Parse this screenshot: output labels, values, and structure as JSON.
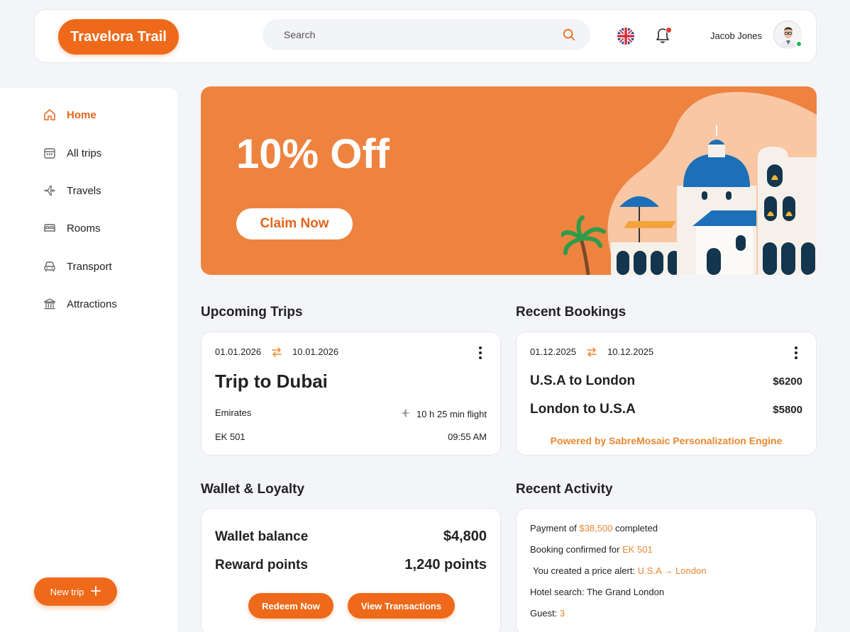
{
  "header": {
    "logo": "Travelora Trail",
    "search_placeholder": "Search",
    "user_name": "Jacob Jones"
  },
  "sidebar": {
    "items": [
      {
        "label": "Home",
        "icon": "home-icon",
        "active": true
      },
      {
        "label": "All trips",
        "icon": "calendar-icon"
      },
      {
        "label": "Travels",
        "icon": "plane-icon"
      },
      {
        "label": "Rooms",
        "icon": "bed-icon"
      },
      {
        "label": "Transport",
        "icon": "car-icon"
      },
      {
        "label": "Attractions",
        "icon": "museum-icon"
      }
    ],
    "new_trip": "New trip"
  },
  "banner": {
    "title": "10% Off",
    "button": "Claim Now"
  },
  "upcoming": {
    "title": "Upcoming Trips",
    "date_from": "01.01.2026",
    "date_to": "10.01.2026",
    "trip_title": "Trip to Dubai",
    "airline": "Emirates",
    "duration": "10 h 25 min flight",
    "flight_no": "EK 501",
    "time": "09:55 AM"
  },
  "bookings": {
    "title": "Recent Bookings",
    "date_from": "01.12.2025",
    "date_to": "10.12.2025",
    "items": [
      {
        "route": "U.S.A to London",
        "price": "$6200"
      },
      {
        "route": "London to U.S.A",
        "price": "$5800"
      }
    ],
    "powered": "Powered by SabreMosaic Personalization Engine"
  },
  "wallet": {
    "title": "Wallet & Loyalty",
    "balance_label": "Wallet balance",
    "balance_value": "$4,800",
    "points_label": "Reward points",
    "points_value": "1,240 points",
    "redeem": "Redeem Now",
    "transactions": "View Transactions"
  },
  "activity": {
    "title": "Recent Activity",
    "lines": [
      {
        "pre": "Payment of ",
        "hl": "$38,500",
        "post": " completed"
      },
      {
        "pre": "Booking confirmed for ",
        "hl": "EK 501",
        "post": ""
      },
      {
        "pre": "You created a price alert: ",
        "hl": "U.S.A → London",
        "post": ""
      },
      {
        "pre": "Hotel search: The Grand London",
        "hl": "",
        "post": ""
      },
      {
        "pre": "Guest: ",
        "hl": "3",
        "post": ""
      }
    ]
  },
  "colors": {
    "accent": "#ee6a1a",
    "banner": "#ee8340",
    "highlight": "#e9872f"
  }
}
